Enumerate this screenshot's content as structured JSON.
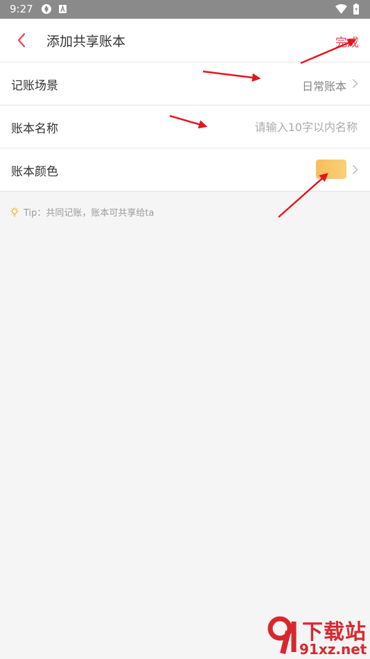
{
  "status_bar": {
    "time": "9:27",
    "icons": [
      "app-icon",
      "a-icon",
      "wifi-icon",
      "battery-icon"
    ]
  },
  "header": {
    "title": "添加共享账本",
    "done_label": "完成",
    "back_icon": "chevron-left-icon"
  },
  "form": {
    "scene": {
      "label": "记账场景",
      "value": "日常账本"
    },
    "name": {
      "label": "账本名称",
      "placeholder": "请输入10字以内名称",
      "value": ""
    },
    "color": {
      "label": "账本颜色",
      "swatch_color": "#f7c566"
    }
  },
  "tip": {
    "text": "Tip：共同记账，账本可共享给ta"
  },
  "watermark": {
    "brand": "下载站",
    "url": "91xz.net"
  },
  "colors": {
    "accent": "#e8404f",
    "annotation_arrow": "#e8141c"
  }
}
